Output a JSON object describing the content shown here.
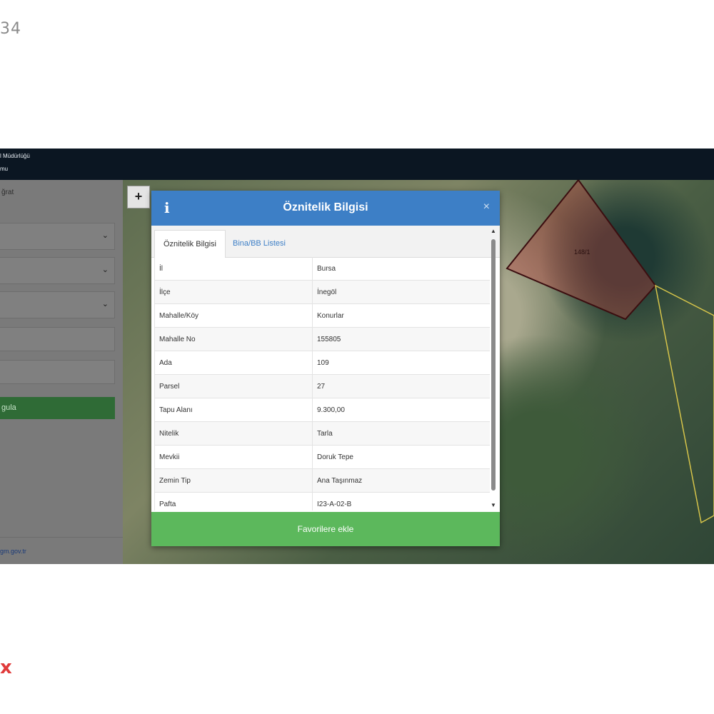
{
  "page_number": "34",
  "corner_mark": "x",
  "topbar": {
    "line1": "l Müdürlüğü",
    "line2": "mu"
  },
  "sidebar": {
    "top_label": "ğrat",
    "green_button": "gula",
    "footer_link": "gm.gov.tr"
  },
  "map": {
    "zoom_in": "+",
    "parcel_label": "148/1"
  },
  "dialog": {
    "info_icon": "i",
    "title": "Öznitelik Bilgisi",
    "close": "×",
    "tabs": [
      {
        "label": "Öznitelik Bilgisi"
      },
      {
        "label": "Bina/BB Listesi"
      }
    ],
    "rows": [
      {
        "key": "İl",
        "value": "Bursa"
      },
      {
        "key": "İlçe",
        "value": "İnegöl"
      },
      {
        "key": "Mahalle/Köy",
        "value": "Konurlar"
      },
      {
        "key": "Mahalle No",
        "value": "155805"
      },
      {
        "key": "Ada",
        "value": "109"
      },
      {
        "key": "Parsel",
        "value": "27"
      },
      {
        "key": "Tapu Alanı",
        "value": "9.300,00"
      },
      {
        "key": "Nitelik",
        "value": "Tarla"
      },
      {
        "key": "Mevkii",
        "value": "Doruk Tepe"
      },
      {
        "key": "Zemin Tip",
        "value": "Ana Taşınmaz"
      },
      {
        "key": "Pafta",
        "value": "I23-A-02-B"
      }
    ],
    "favorite_button": "Favorilere ekle"
  }
}
